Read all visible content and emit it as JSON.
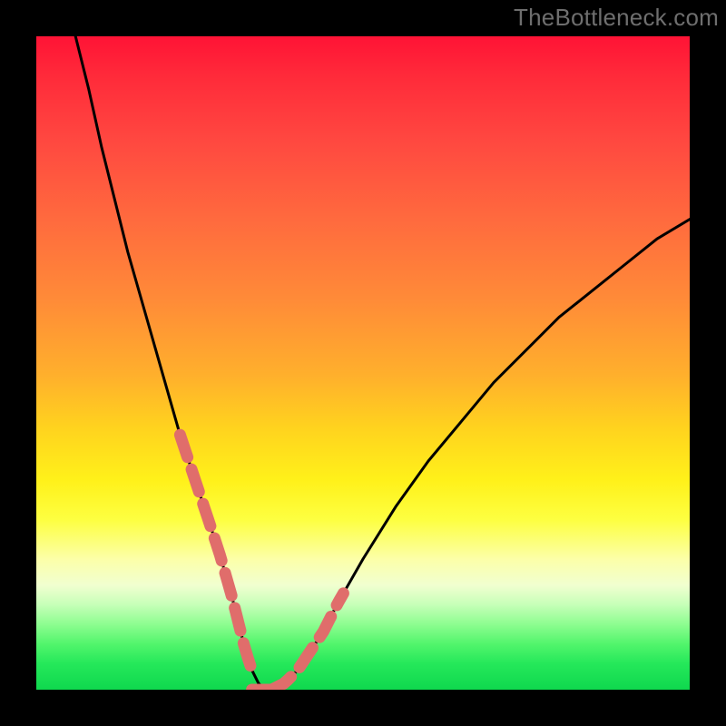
{
  "watermark": "TheBottleneck.com",
  "colors": {
    "page_bg": "#000000",
    "curve": "#000000",
    "dash_stroke": "#e06d6b",
    "gradient_stops": [
      "#ff1335",
      "#ff4840",
      "#ff8a38",
      "#ffd31e",
      "#fdff41",
      "#f1ffd0",
      "#52f56c",
      "#0fd84e"
    ]
  },
  "chart_data": {
    "type": "line",
    "title": "",
    "xlabel": "",
    "ylabel": "",
    "xlim": [
      0,
      100
    ],
    "ylim": [
      0,
      100
    ],
    "grid": false,
    "legend": false,
    "series": [
      {
        "name": "bottleneck-curve",
        "x": [
          6,
          8,
          10,
          12,
          14,
          16,
          18,
          20,
          22,
          24,
          26,
          28,
          30,
          31,
          32,
          33,
          34,
          35,
          36,
          38,
          40,
          42,
          44,
          46,
          50,
          55,
          60,
          65,
          70,
          75,
          80,
          85,
          90,
          95,
          100
        ],
        "y": [
          100,
          92,
          83,
          75,
          67,
          60,
          53,
          46,
          39,
          33,
          27,
          21,
          14,
          10,
          6,
          3,
          1,
          0,
          0,
          1,
          3,
          6,
          9,
          13,
          20,
          28,
          35,
          41,
          47,
          52,
          57,
          61,
          65,
          69,
          72
        ]
      }
    ],
    "dash_segments_left": {
      "comment": "salmon dashed overlay on descending branch near bottom",
      "x_range": [
        22,
        33
      ],
      "y_range": [
        28,
        2
      ]
    },
    "dash_segments_right": {
      "comment": "salmon dashed overlay on ascending branch near bottom",
      "x_range": [
        36,
        47
      ],
      "y_range": [
        2,
        28
      ]
    },
    "flat_bottom": {
      "x_range": [
        33,
        37
      ],
      "y": 0
    }
  }
}
